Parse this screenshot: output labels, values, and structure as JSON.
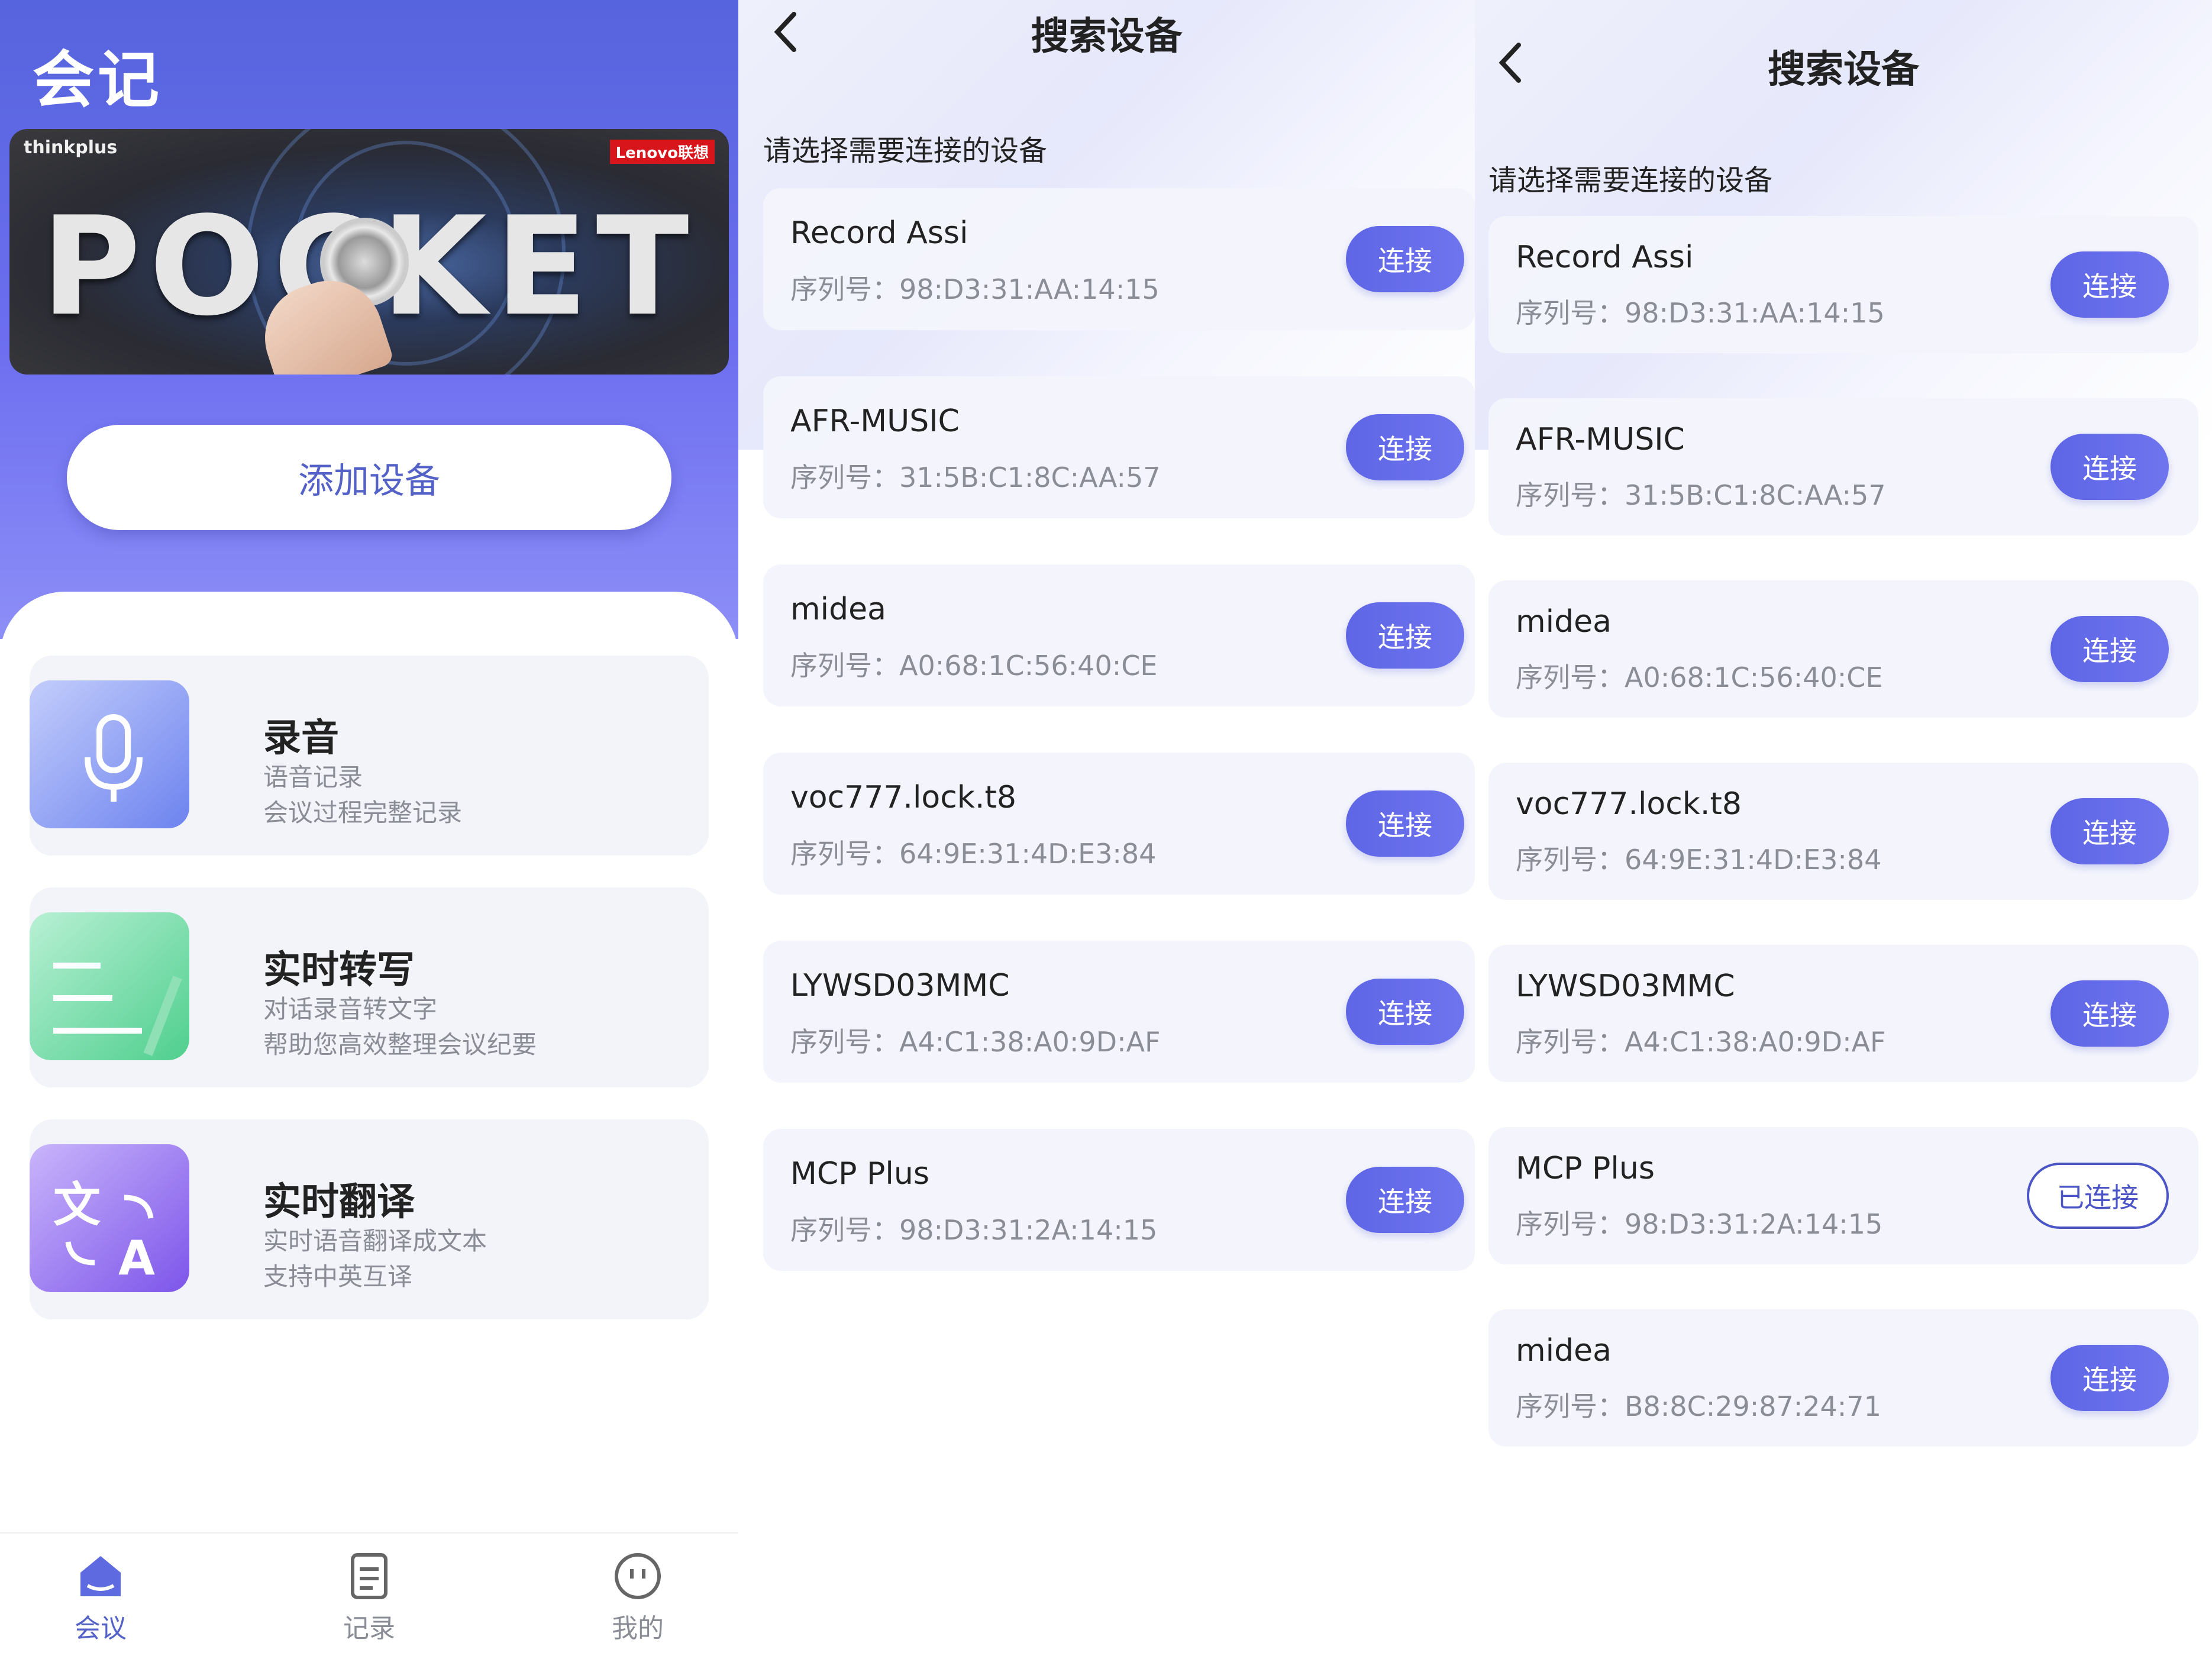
{
  "home": {
    "app_title": "会记",
    "banner": {
      "brand_left": "thinkplus",
      "brand_right": "Lenovo联想",
      "word": "POCKET"
    },
    "add_device_label": "添加设备",
    "features": [
      {
        "title": "录音",
        "line1": "语音记录",
        "line2": "会议过程完整记录",
        "icon": "microphone-icon"
      },
      {
        "title": "实时转写",
        "line1": "对话录音转文字",
        "line2": "帮助您高效整理会议纪要",
        "icon": "transcribe-note-icon"
      },
      {
        "title": "实时翻译",
        "line1": "实时语音翻译成文本",
        "line2": "支持中英互译",
        "icon": "translate-icon"
      }
    ],
    "tabs": [
      {
        "label": "会议",
        "icon": "meeting-home-icon",
        "active": true
      },
      {
        "label": "记录",
        "icon": "records-doc-icon",
        "active": false
      },
      {
        "label": "我的",
        "icon": "profile-face-icon",
        "active": false
      }
    ],
    "accent_color": "#5462c8"
  },
  "search1": {
    "title": "搜索设备",
    "hint": "请选择需要连接的设备",
    "devices": [
      {
        "name": "Record Assi",
        "serial": "序列号：98:D3:31:AA:14:15",
        "action": "连接"
      },
      {
        "name": "AFR-MUSIC",
        "serial": "序列号：31:5B:C1:8C:AA:57",
        "action": "连接"
      },
      {
        "name": "midea",
        "serial": "序列号：A0:68:1C:56:40:CE",
        "action": "连接"
      },
      {
        "name": "voc777.lock.t8",
        "serial": "序列号：64:9E:31:4D:E3:84",
        "action": "连接"
      },
      {
        "name": "LYWSD03MMC",
        "serial": "序列号：A4:C1:38:A0:9D:AF",
        "action": "连接"
      },
      {
        "name": "MCP Plus",
        "serial": "序列号：98:D3:31:2A:14:15",
        "action": "连接"
      }
    ]
  },
  "search2": {
    "title": "搜索设备",
    "hint": "请选择需要连接的设备",
    "devices": [
      {
        "name": "Record Assi",
        "serial": "序列号：98:D3:31:AA:14:15",
        "action": "连接"
      },
      {
        "name": "AFR-MUSIC",
        "serial": "序列号：31:5B:C1:8C:AA:57",
        "action": "连接"
      },
      {
        "name": "midea",
        "serial": "序列号：A0:68:1C:56:40:CE",
        "action": "连接"
      },
      {
        "name": "voc777.lock.t8",
        "serial": "序列号：64:9E:31:4D:E3:84",
        "action": "连接"
      },
      {
        "name": "LYWSD03MMC",
        "serial": "序列号：A4:C1:38:A0:9D:AF",
        "action": "连接"
      },
      {
        "name": "MCP Plus",
        "serial": "序列号：98:D3:31:2A:14:15",
        "action": "已连接"
      },
      {
        "name": "midea",
        "serial": "序列号：B8:8C:29:87:24:71",
        "action": "连接"
      }
    ]
  }
}
